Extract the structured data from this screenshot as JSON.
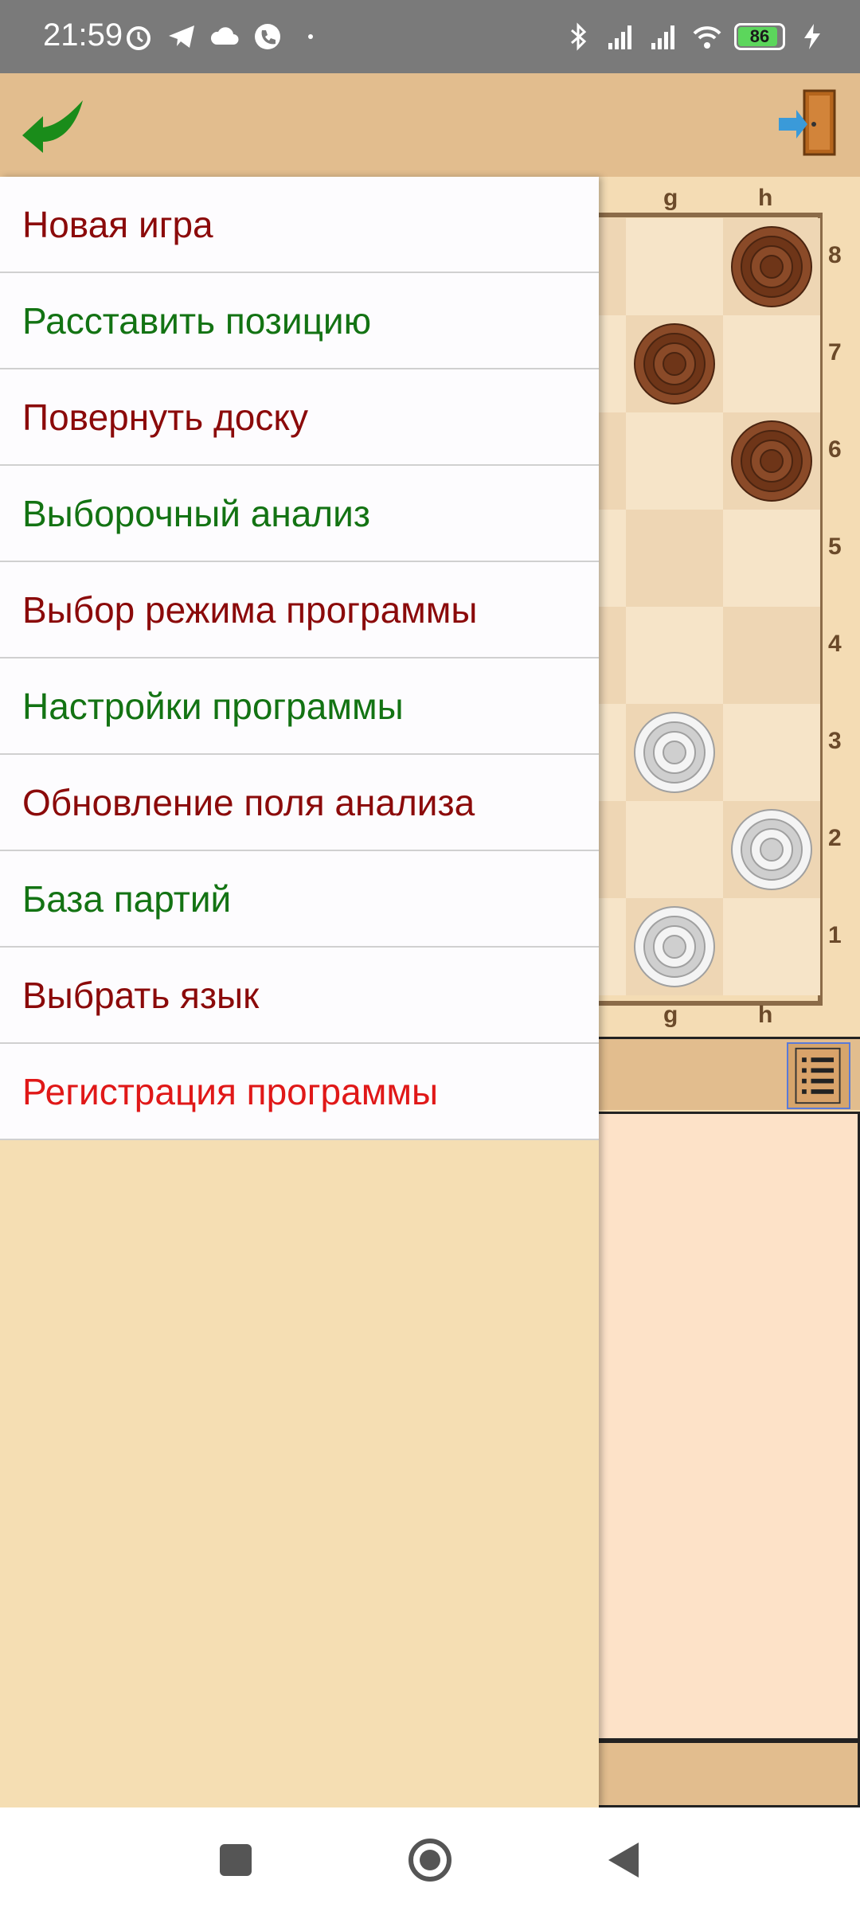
{
  "status_bar": {
    "time": "21:59",
    "battery": "86"
  },
  "menu": {
    "items": [
      {
        "label": "Новая игра",
        "color": "#8b0a0a"
      },
      {
        "label": "Расставить позицию",
        "color": "#137313"
      },
      {
        "label": "Повернуть доску",
        "color": "#8b0a0a"
      },
      {
        "label": "Выборочный анализ",
        "color": "#137313"
      },
      {
        "label": "Выбор режима программы",
        "color": "#8b0a0a"
      },
      {
        "label": "Настройки программы",
        "color": "#137313"
      },
      {
        "label": "Обновление поля анализа",
        "color": "#8b0a0a"
      },
      {
        "label": "База партий",
        "color": "#137313"
      },
      {
        "label": "Выбрать язык",
        "color": "#8b0a0a"
      },
      {
        "label": "Регистрация программы",
        "color": "#e01818"
      }
    ]
  },
  "board": {
    "file_labels": [
      "g",
      "h"
    ],
    "rank_labels": [
      "8",
      "7",
      "6",
      "5",
      "4",
      "3",
      "2",
      "1"
    ]
  },
  "icons": {
    "back": "back-arrow-icon",
    "exit": "exit-door-icon",
    "notation": "notation-list-icon"
  },
  "colors": {
    "toolbar": "#e2bd8e",
    "drawer_bg": "#f5deb3",
    "dark_piece": "#8a4a28",
    "light_piece": "#f2f2f2"
  }
}
